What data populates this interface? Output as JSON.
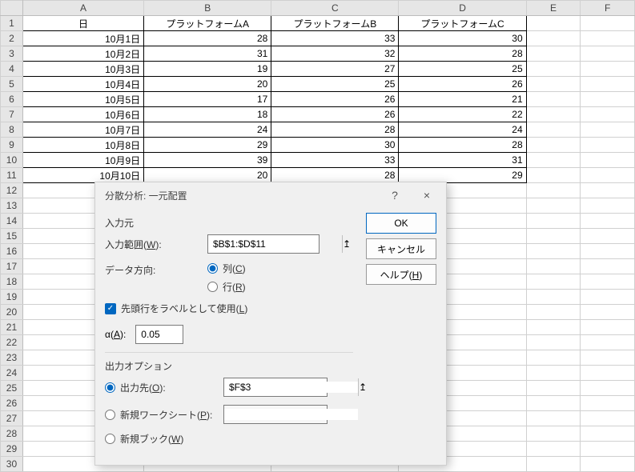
{
  "columns": [
    "A",
    "B",
    "C",
    "D",
    "E",
    "F"
  ],
  "headers": {
    "A": "日",
    "B": "プラットフォームA",
    "C": "プラットフォームB",
    "D": "プラットフォームC"
  },
  "rows": [
    {
      "A": "10月1日",
      "B": 28,
      "C": 33,
      "D": 30
    },
    {
      "A": "10月2日",
      "B": 31,
      "C": 32,
      "D": 28
    },
    {
      "A": "10月3日",
      "B": 19,
      "C": 27,
      "D": 25
    },
    {
      "A": "10月4日",
      "B": 20,
      "C": 25,
      "D": 26
    },
    {
      "A": "10月5日",
      "B": 17,
      "C": 26,
      "D": 21
    },
    {
      "A": "10月6日",
      "B": 18,
      "C": 26,
      "D": 22
    },
    {
      "A": "10月7日",
      "B": 24,
      "C": 28,
      "D": 24
    },
    {
      "A": "10月8日",
      "B": 29,
      "C": 30,
      "D": 28
    },
    {
      "A": "10月9日",
      "B": 39,
      "C": 33,
      "D": 31
    },
    {
      "A": "10月10日",
      "B": 20,
      "C": 28,
      "D": 29
    }
  ],
  "visibleRowNumbers": 30,
  "dialog": {
    "title": "分散分析: 一元配置",
    "help_icon": "?",
    "close_icon": "×",
    "section_input": "入力元",
    "input_range_label": "入力範囲(W):",
    "input_range_value": "$B$1:$D$11",
    "data_direction_label": "データ方向:",
    "direction_col": "列(C)",
    "direction_row": "行(R)",
    "direction_selected": "col",
    "labels_first_row": "先頭行をラベルとして使用(L)",
    "labels_first_row_checked": true,
    "alpha_label": "α(A):",
    "alpha_value": "0.05",
    "section_output": "出力オプション",
    "output_dest_label": "出力先(O):",
    "output_dest_value": "$F$3",
    "output_selected": "dest",
    "new_worksheet_label": "新規ワークシート(P):",
    "new_worksheet_value": "",
    "new_workbook_label": "新規ブック(W)",
    "btn_ok": "OK",
    "btn_cancel": "キャンセル",
    "btn_help": "ヘルプ(H)",
    "ref_icon": "↥"
  }
}
